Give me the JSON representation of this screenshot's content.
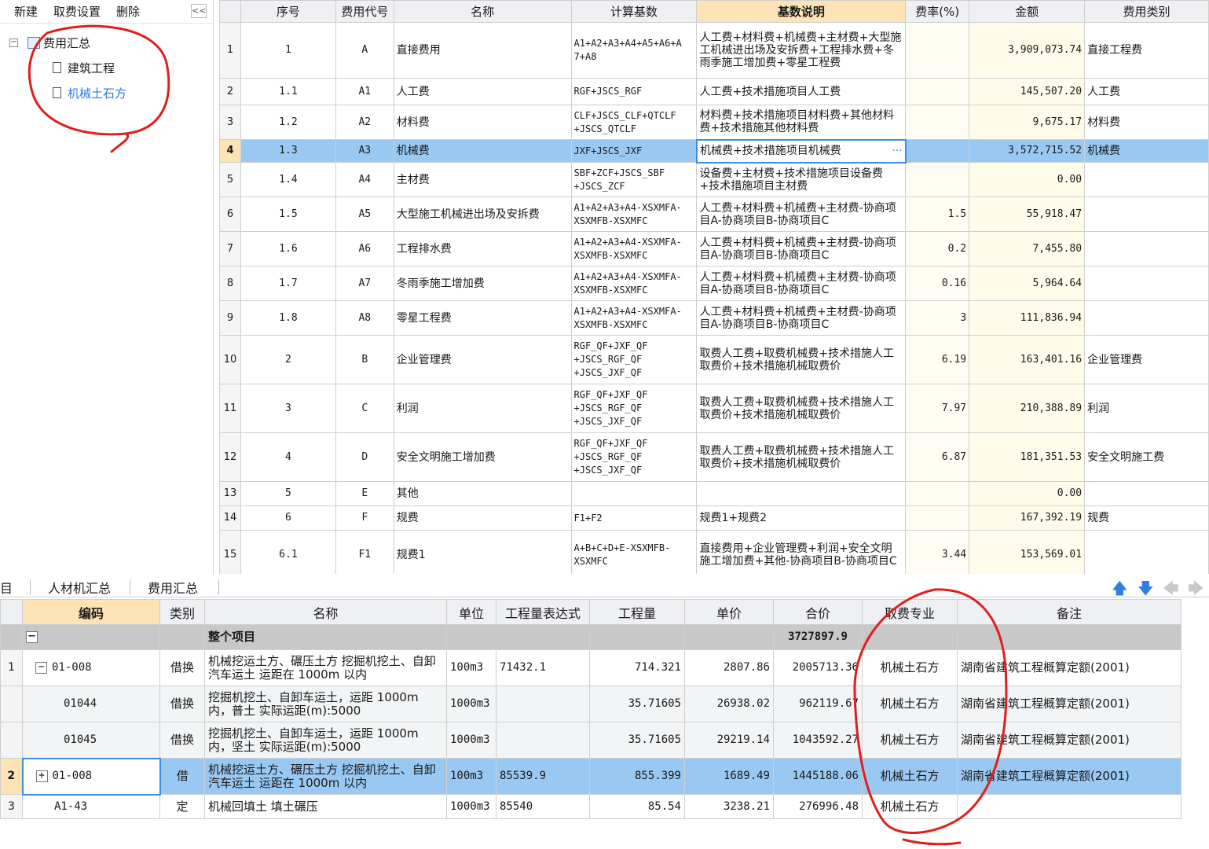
{
  "sidebar": {
    "toolbar": {
      "new": "新建",
      "fee_settings": "取费设置",
      "delete": "删除",
      "collapse": "<<"
    },
    "tree": {
      "root": "费用汇总",
      "children": [
        "建筑工程",
        "机械土石方"
      ]
    }
  },
  "fee_table": {
    "headers": [
      "序号",
      "费用代号",
      "名称",
      "计算基数",
      "基数说明",
      "费率(%)",
      "金额",
      "费用类别"
    ],
    "rows": [
      {
        "idx": "1",
        "seq": "1",
        "code": "A",
        "name": "直接费用",
        "base": "A1+A2+A3+A4+A5+A6+A\n7+A8",
        "desc": "人工费+材料费+机械费+主材费+大型施工机械进出场及安拆费+工程排水费+冬雨季施工增加费+零星工程费",
        "rate": "",
        "amount": "3,909,073.74",
        "category": "直接工程费"
      },
      {
        "idx": "2",
        "seq": "1.1",
        "code": "A1",
        "name": "人工费",
        "base": "RGF+JSCS_RGF",
        "desc": "人工费+技术措施项目人工费",
        "rate": "",
        "amount": "145,507.20",
        "category": "人工费"
      },
      {
        "idx": "3",
        "seq": "1.2",
        "code": "A2",
        "name": "材料费",
        "base": "CLF+JSCS_CLF+QTCLF\n+JSCS_QTCLF",
        "desc": "材料费+技术措施项目材料费+其他材料费+技术措施其他材料费",
        "rate": "",
        "amount": "9,675.17",
        "category": "材料费"
      },
      {
        "idx": "4",
        "seq": "1.3",
        "code": "A3",
        "name": "机械费",
        "base": "JXF+JSCS_JXF",
        "desc": "机械费+技术措施项目机械费",
        "rate": "",
        "amount": "3,572,715.52",
        "category": "机械费"
      },
      {
        "idx": "5",
        "seq": "1.4",
        "code": "A4",
        "name": "主材费",
        "base": "SBF+ZCF+JSCS_SBF\n+JSCS_ZCF",
        "desc": "设备费+主材费+技术措施项目设备费+技术措施项目主材费",
        "rate": "",
        "amount": "0.00",
        "category": ""
      },
      {
        "idx": "6",
        "seq": "1.5",
        "code": "A5",
        "name": "大型施工机械进出场及安拆费",
        "base": "A1+A2+A3+A4-XSXMFA-\nXSXMFB-XSXMFC",
        "desc": "人工费+材料费+机械费+主材费-协商项目A-协商项目B-协商项目C",
        "rate": "1.5",
        "amount": "55,918.47",
        "category": ""
      },
      {
        "idx": "7",
        "seq": "1.6",
        "code": "A6",
        "name": "工程排水费",
        "base": "A1+A2+A3+A4-XSXMFA-\nXSXMFB-XSXMFC",
        "desc": "人工费+材料费+机械费+主材费-协商项目A-协商项目B-协商项目C",
        "rate": "0.2",
        "amount": "7,455.80",
        "category": ""
      },
      {
        "idx": "8",
        "seq": "1.7",
        "code": "A7",
        "name": "冬雨季施工增加费",
        "base": "A1+A2+A3+A4-XSXMFA-\nXSXMFB-XSXMFC",
        "desc": "人工费+材料费+机械费+主材费-协商项目A-协商项目B-协商项目C",
        "rate": "0.16",
        "amount": "5,964.64",
        "category": ""
      },
      {
        "idx": "9",
        "seq": "1.8",
        "code": "A8",
        "name": "零星工程费",
        "base": "A1+A2+A3+A4-XSXMFA-\nXSXMFB-XSXMFC",
        "desc": "人工费+材料费+机械费+主材费-协商项目A-协商项目B-协商项目C",
        "rate": "3",
        "amount": "111,836.94",
        "category": ""
      },
      {
        "idx": "10",
        "seq": "2",
        "code": "B",
        "name": "企业管理费",
        "base": "RGF_QF+JXF_QF\n+JSCS_RGF_QF\n+JSCS_JXF_QF",
        "desc": "取费人工费+取费机械费+技术措施人工取费价+技术措施机械取费价",
        "rate": "6.19",
        "amount": "163,401.16",
        "category": "企业管理费"
      },
      {
        "idx": "11",
        "seq": "3",
        "code": "C",
        "name": "利润",
        "base": "RGF_QF+JXF_QF\n+JSCS_RGF_QF\n+JSCS_JXF_QF",
        "desc": "取费人工费+取费机械费+技术措施人工取费价+技术措施机械取费价",
        "rate": "7.97",
        "amount": "210,388.89",
        "category": "利润"
      },
      {
        "idx": "12",
        "seq": "4",
        "code": "D",
        "name": "安全文明施工增加费",
        "base": "RGF_QF+JXF_QF\n+JSCS_RGF_QF\n+JSCS_JXF_QF",
        "desc": "取费人工费+取费机械费+技术措施人工取费价+技术措施机械取费价",
        "rate": "6.87",
        "amount": "181,351.53",
        "category": "安全文明施工费"
      },
      {
        "idx": "13",
        "seq": "5",
        "code": "E",
        "name": "其他",
        "base": "",
        "desc": "",
        "rate": "",
        "amount": "0.00",
        "category": ""
      },
      {
        "idx": "14",
        "seq": "6",
        "code": "F",
        "name": "规费",
        "base": "F1+F2",
        "desc": "规费1+规费2",
        "rate": "",
        "amount": "167,392.19",
        "category": "规费"
      },
      {
        "idx": "15",
        "seq": "6.1",
        "code": "F1",
        "name": "规费1",
        "base": "A+B+C+D+E-XSXMFB-\nXSXMFC",
        "desc": "直接费用+企业管理费+利润+安全文明施工增加费+其他-协商项目B-协商项目C",
        "rate": "3.44",
        "amount": "153,569.01",
        "category": ""
      }
    ],
    "selected_index": 3
  },
  "tabs": {
    "partial": "目",
    "labor_material": "人材机汇总",
    "fee_summary": "费用汇总"
  },
  "item_table": {
    "headers": [
      "编码",
      "类别",
      "名称",
      "单位",
      "工程量表达式",
      "工程量",
      "单价",
      "合价",
      "取费专业",
      "备注"
    ],
    "group": {
      "name": "整个项目",
      "total": "3727897.9"
    },
    "rows": [
      {
        "idx": "1",
        "code": "01-008",
        "box": "−",
        "indent": 0,
        "type": "借换",
        "name": "机械挖运土方、碾压土方 挖掘机挖土、自卸汽车运土 运距在 1000m 以内",
        "unit": "100m3",
        "expr": "71432.1",
        "qty": "714.321",
        "price": "2807.86",
        "total": "2005713.36",
        "prof": "机械土石方",
        "remark": "湖南省建筑工程概算定额(2001)",
        "style": "plain"
      },
      {
        "idx": "",
        "code": "01044",
        "box": "",
        "indent": 1,
        "type": "借换",
        "name": "挖掘机挖土、自卸车运土，运距 1000m 内，普土  实际运距(m):5000",
        "unit": "1000m3",
        "expr": "",
        "qty": "35.71605",
        "price": "26938.02",
        "total": "962119.67",
        "prof": "机械土石方",
        "remark": "湖南省建筑工程概算定额(2001)",
        "style": "alt"
      },
      {
        "idx": "",
        "code": "01045",
        "box": "",
        "indent": 1,
        "type": "借换",
        "name": "挖掘机挖土、自卸车运土，运距 1000m 内，坚土  实际运距(m):5000",
        "unit": "1000m3",
        "expr": "",
        "qty": "35.71605",
        "price": "29219.14",
        "total": "1043592.27",
        "prof": "机械土石方",
        "remark": "湖南省建筑工程概算定额(2001)",
        "style": "alt"
      },
      {
        "idx": "2",
        "code": "01-008",
        "box": "+",
        "indent": 0,
        "type": "借",
        "name": "机械挖运土方、碾压土方 挖掘机挖土、自卸汽车运土 运距在 1000m 以内",
        "unit": "100m3",
        "expr": "85539.9",
        "qty": "855.399",
        "price": "1689.49",
        "total": "1445188.06",
        "prof": "机械土石方",
        "remark": "湖南省建筑工程概算定额(2001)",
        "style": "sel"
      },
      {
        "idx": "3",
        "code": "A1-43",
        "box": "",
        "indent": 0,
        "type": "定",
        "name": "机械回填土 填土碾压",
        "unit": "1000m3",
        "expr": "85540",
        "qty": "85.54",
        "price": "3238.21",
        "total": "276996.48",
        "prof": "机械土石方",
        "remark": "",
        "style": "plain"
      }
    ]
  },
  "colors": {
    "selection": "#99c9f3",
    "header_highlight": "#fde3b6",
    "annotation": "#e01e1e",
    "tree_link": "#2f7bd9",
    "arrow_active": "#2d7fe0",
    "arrow_inactive": "#c9c9c9"
  },
  "icons": [
    "collapse-icon",
    "folder-icon",
    "document-icon",
    "expand-box-icon",
    "arrow-up-icon",
    "arrow-down-icon",
    "arrow-left-icon",
    "arrow-right-icon"
  ]
}
